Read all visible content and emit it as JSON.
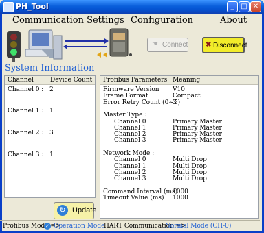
{
  "window": {
    "title": "PH_Tool"
  },
  "menu": [
    "Communication Settings",
    "Configuration",
    "About"
  ],
  "toolbar": {
    "connect_label": "Connect",
    "disconnect_label": "Disconnect"
  },
  "system_info_title": "System Information",
  "left_table": {
    "headers": [
      "Channel",
      "Device Count"
    ],
    "rows": [
      {
        "channel": "Channel 0 :",
        "count": "2"
      },
      {
        "channel": "Channel 1 :",
        "count": "1"
      },
      {
        "channel": "Channel 2 :",
        "count": "3"
      },
      {
        "channel": "Channel 3 :",
        "count": "1"
      }
    ]
  },
  "update_label": "Update",
  "right_table": {
    "headers": [
      "Profibus Parameters",
      "Meaning"
    ],
    "rows": [
      {
        "param": "Firmware Version",
        "value": "V10",
        "indent": false
      },
      {
        "param": "Frame Format",
        "value": "Compact",
        "indent": false
      },
      {
        "param": "Error Retry Count (0~5)",
        "value": "3",
        "indent": false
      },
      {
        "param": "",
        "value": "",
        "indent": false
      },
      {
        "param": "Master Type :",
        "value": "",
        "indent": false
      },
      {
        "param": "Channel 0",
        "value": "Primary Master",
        "indent": true
      },
      {
        "param": "Channel 1",
        "value": "Primary Master",
        "indent": true
      },
      {
        "param": "Channel 2",
        "value": "Primary Master",
        "indent": true
      },
      {
        "param": "Channel 3",
        "value": "Primary Master",
        "indent": true
      },
      {
        "param": "",
        "value": "",
        "indent": false
      },
      {
        "param": "Network Mode :",
        "value": "",
        "indent": false
      },
      {
        "param": "Channel 0",
        "value": "Multi Drop",
        "indent": true
      },
      {
        "param": "Channel 1",
        "value": "Multi Drop",
        "indent": true
      },
      {
        "param": "Channel 2",
        "value": "Multi Drop",
        "indent": true
      },
      {
        "param": "Channel 3",
        "value": "Multi Drop",
        "indent": true
      },
      {
        "param": "",
        "value": "",
        "indent": false
      },
      {
        "param": "Command Interval (ms)",
        "value": "1000",
        "indent": false
      },
      {
        "param": "Timeout Value (ms)",
        "value": "1000",
        "indent": false
      }
    ]
  },
  "status": {
    "profibus_label": "Profibus Mode =>",
    "profibus_value": "Operation Mode",
    "hart_label": "HART Communication =>",
    "hart_value": "Normal Mode (CH-0)"
  }
}
